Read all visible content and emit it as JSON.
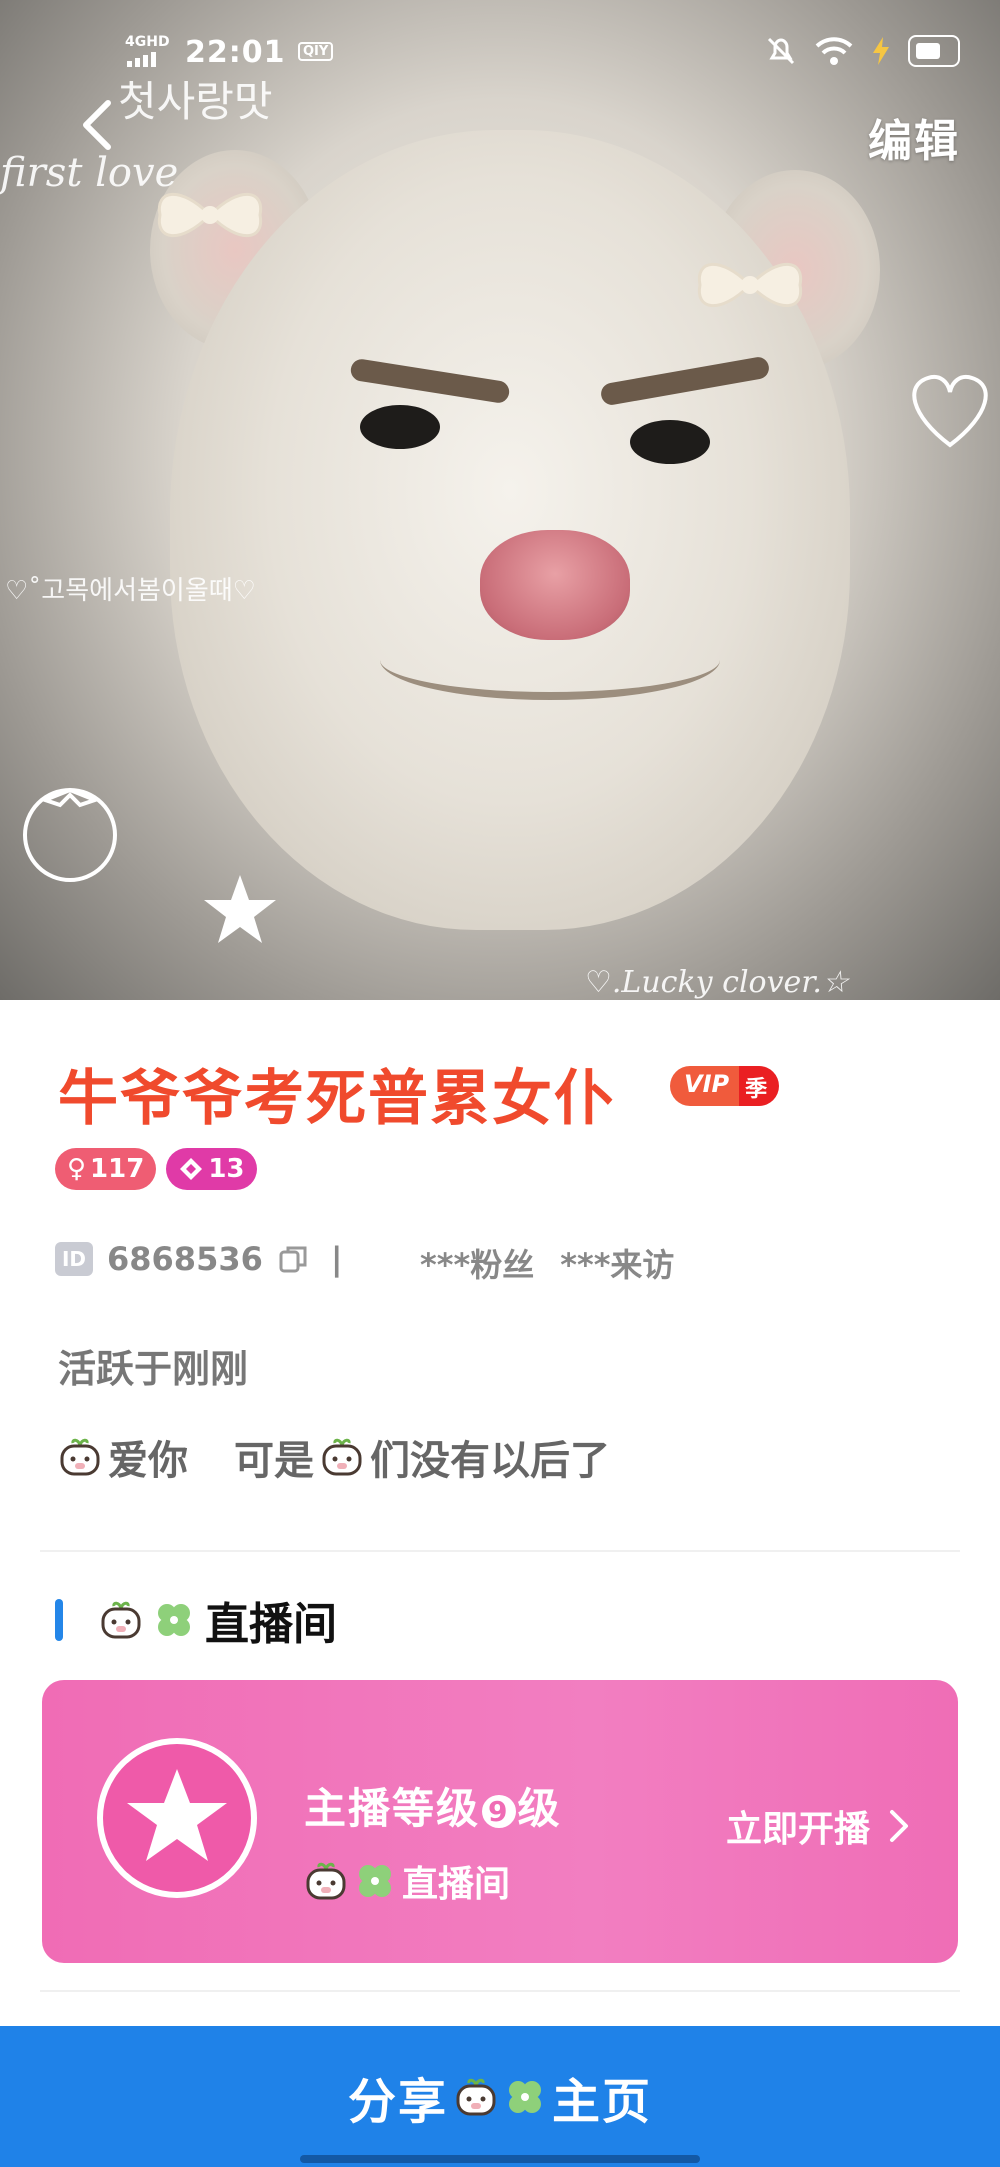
{
  "status_bar": {
    "network": "4GHD",
    "time": "22:01",
    "app_badge": "QIY"
  },
  "header": {
    "edit_label": "编辑"
  },
  "cover_text": {
    "korean_title": "첫사랑맛",
    "first_love": "first love",
    "korean_caption": "♡˚고목에서봄이올때♡",
    "lucky": "♡.Lucky clover.☆"
  },
  "profile": {
    "name": "牛爷爷考死普累女仆",
    "vip_label": "VIP",
    "vip_season": "季",
    "gender_level": "117",
    "wealth_level": "13",
    "id_tag": "ID",
    "id_value": "6868536",
    "separator": "|",
    "fans": "***粉丝",
    "visits": "***来访",
    "active_status": "活跃于刚刚",
    "bio_part1": "爱你",
    "bio_part2": "可是",
    "bio_part3": "们没有以后了"
  },
  "live_section": {
    "title": "直播间",
    "anchor_level_prefix": "主播等级",
    "anchor_level_value": "9",
    "anchor_level_suffix": "级",
    "room_name": "直播间",
    "start_label": "立即开播"
  },
  "footer": {
    "share_prefix": "分享",
    "share_suffix": "主页"
  },
  "colors": {
    "name_red": "#f04a2d",
    "accent_blue": "#1f82e8",
    "card_pink": "#f06cb5"
  }
}
